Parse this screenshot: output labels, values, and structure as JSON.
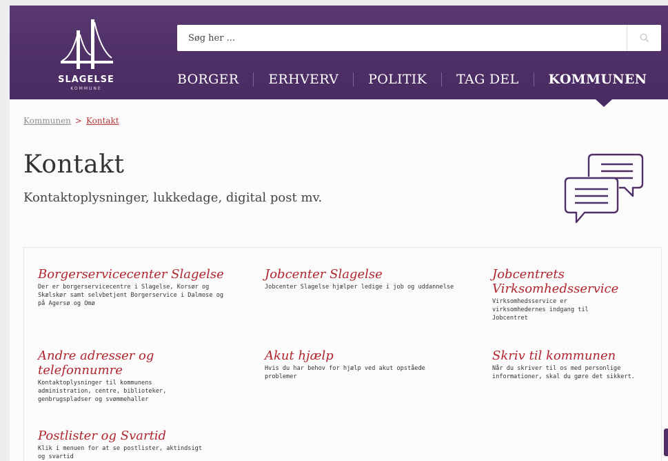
{
  "header": {
    "logo": {
      "name": "SLAGELSE",
      "sub": "KOMMUNE"
    },
    "search": {
      "placeholder": "Søg her ..."
    },
    "nav": [
      {
        "label": "BORGER"
      },
      {
        "label": "ERHVERV"
      },
      {
        "label": "POLITIK"
      },
      {
        "label": "TAG DEL"
      },
      {
        "label": "KOMMUNEN",
        "active": true
      }
    ]
  },
  "breadcrumb": {
    "home": "Kommunen",
    "separator": ">",
    "current": "Kontakt"
  },
  "page": {
    "title": "Kontakt",
    "subtitle": "Kontaktoplysninger, lukkedage, digital post mv."
  },
  "cards": [
    {
      "title": "Borgerservicecenter Slagelse",
      "desc": "Der er borgerservicecentre i Slagelse, Korsør og Skælskør samt selvbetjent Borgerservice i Dalmose og på Agersø og Omø"
    },
    {
      "title": "Jobcenter Slagelse",
      "desc": "Jobcenter Slagelse hjælper ledige i job og uddannelse"
    },
    {
      "title": "Jobcentrets Virksomhedsservice",
      "desc": "Virksomhedsservice er virksomhedernes indgang til Jobcentret"
    },
    {
      "title": "Andre adresser og telefonnumre",
      "desc": "Kontaktoplysninger til kommunens administration, centre, biblioteker, genbrugspladser og svømmehaller"
    },
    {
      "title": "Akut hjælp",
      "desc": "Hvis du har behov for hjælp ved akut opståede problemer"
    },
    {
      "title": "Skriv til kommunen",
      "desc": "Når du skriver til os med personlige informationer, skal du gøre det sikkert."
    },
    {
      "title": "Postlister og Svartid",
      "desc": "Klik i menuen for at se postlister, aktindsigt og svartid"
    }
  ],
  "icons": {
    "search": "search-icon",
    "chat": "chat-bubbles-icon",
    "logo": "bridge-logo-icon"
  },
  "colors": {
    "brand": "#4e2f66",
    "link": "#b0252f",
    "breadcrumb_current": "#b33a3a"
  }
}
